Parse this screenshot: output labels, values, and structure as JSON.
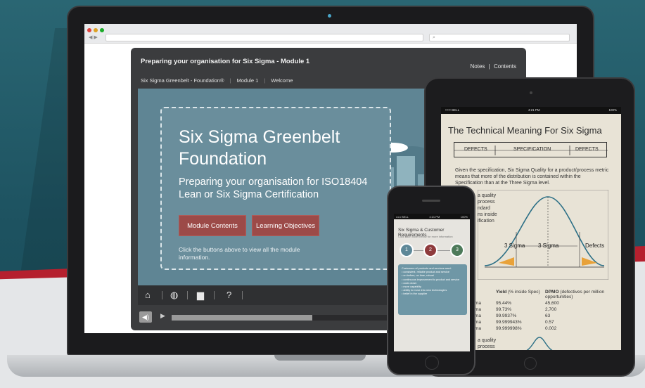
{
  "player": {
    "title": "Preparing your organisation for Six Sigma - Module 1",
    "links": {
      "notes": "Notes",
      "separator": "|",
      "contents": "Contents"
    },
    "breadcrumbs": [
      "Six Sigma Greenbelt - Foundation®",
      "Module 1",
      "Welcome"
    ],
    "card": {
      "title": "Six Sigma Greenbelt Foundation",
      "subtitle": "Preparing your organisation for ISO18404 Lean or Six Sigma Certification",
      "button_contents": "Module Contents",
      "button_objectives": "Learning Objectives",
      "note": "Click the buttons above to view all the module information."
    },
    "toolbar_icons": [
      "home-icon",
      "globe-icon",
      "chat-icon",
      "help-icon"
    ],
    "progress_fraction": 0.4
  },
  "tablet": {
    "status_left": "••••• BELL",
    "status_time": "4:21 PM",
    "status_right": "100%",
    "title": "The Technical Meaning For Six Sigma",
    "spec_left": "DEFECTS",
    "spec_mid": "SPECIFICATION",
    "spec_right": "DEFECTS",
    "paragraph": "Given the specification, Six Sigma Quality for a product/process metric means that more of the distribution is contained within the Specification than at the Three Sigma level.",
    "chart_labels": [
      "a quality",
      "process",
      "ndard",
      "ns inside",
      "ification"
    ],
    "sigma_left": "3 Sigma",
    "sigma_right": "3 Sigma",
    "defects_label": "Defects",
    "table": {
      "head": {
        "c2": "Yield",
        "c2_sub": "(% inside Spec)",
        "c3": "DPMO",
        "c3_sub": "(defectives per million opportunities)"
      },
      "rows": [
        {
          "c1": "ma",
          "c2": "95.44%",
          "c3": "45,600"
        },
        {
          "c1": "ma",
          "c2": "99.73%",
          "c3": "2,700"
        },
        {
          "c1": "ma",
          "c2": "99.9937%",
          "c3": "63"
        },
        {
          "c1": "ma",
          "c2": "99.999943%",
          "c3": "0.57"
        },
        {
          "c1": "ma",
          "c2": "99.999998%",
          "c3": "0.002"
        }
      ]
    },
    "bottom_labels": [
      "a quality",
      "process"
    ]
  },
  "phone": {
    "status_left": "••••• BELL",
    "status_time": "4:21 PM",
    "status_right": "100%",
    "title": "Six Sigma & Customer Requirements",
    "subtitle": "Click each bullet below for more information",
    "steps": [
      "1",
      "2",
      "3"
    ],
    "bullets": [
      "Customers of products and services want:",
      "• consistent, reliable product and service",
      "• on before, on time, robust",
      "• continuous improvement to product and service",
      "• costs down",
      "• more capability",
      "• ability to move into new technologies",
      "• belief in the supplier"
    ]
  },
  "colors": {
    "background_teal": "#1f5360",
    "accent_red": "#b5202e",
    "button_red": "#9c4a48",
    "stage_blue": "#5f8594"
  }
}
